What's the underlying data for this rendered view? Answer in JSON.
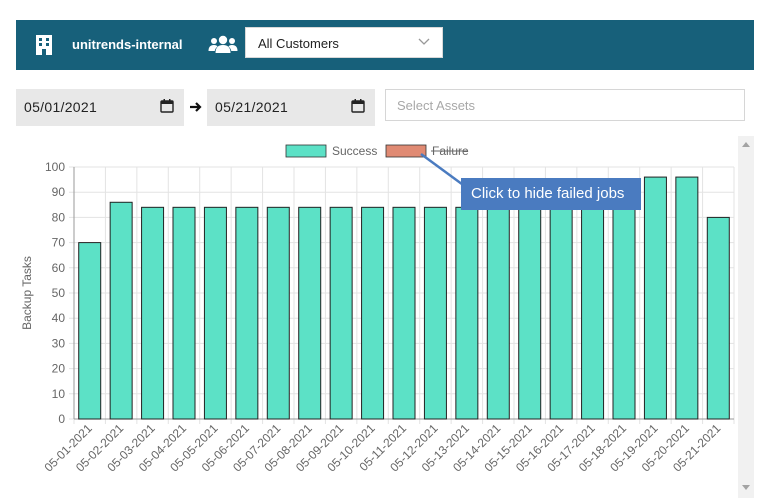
{
  "header": {
    "org_name": "unitrends-internal",
    "org_icon": "building-icon",
    "users_icon": "users-icon",
    "customer_select": {
      "value": "All Customers"
    }
  },
  "filters": {
    "start_date": "05/01/2021",
    "end_date": "05/21/2021",
    "assets_placeholder": "Select Assets"
  },
  "tooltip": {
    "text": "Click to hide failed jobs"
  },
  "colors": {
    "header_bg": "#17607a",
    "success": "#5ce1c6",
    "failure": "#e08a73",
    "tooltip": "#4a7bc0"
  },
  "chart_data": {
    "type": "bar",
    "ylabel": "Backup Tasks",
    "ylim": [
      0,
      100
    ],
    "yticks": [
      "0",
      "10",
      "20",
      "30",
      "40",
      "50",
      "60",
      "70",
      "80",
      "90",
      "100"
    ],
    "categories": [
      "05-01-2021",
      "05-02-2021",
      "05-03-2021",
      "05-04-2021",
      "05-05-2021",
      "05-06-2021",
      "05-07-2021",
      "05-08-2021",
      "05-09-2021",
      "05-10-2021",
      "05-11-2021",
      "05-12-2021",
      "05-13-2021",
      "05-14-2021",
      "05-15-2021",
      "05-16-2021",
      "05-17-2021",
      "05-18-2021",
      "05-19-2021",
      "05-20-2021",
      "05-21-2021"
    ],
    "series": [
      {
        "name": "Success",
        "color": "#5ce1c6",
        "hidden": false,
        "values": [
          70,
          86,
          84,
          84,
          84,
          84,
          84,
          84,
          84,
          84,
          84,
          84,
          84,
          84,
          84,
          84,
          84,
          84,
          96,
          96,
          80
        ]
      },
      {
        "name": "Failure",
        "color": "#e08a73",
        "hidden": true,
        "values": []
      }
    ],
    "legend_position": "top",
    "grid": true
  }
}
